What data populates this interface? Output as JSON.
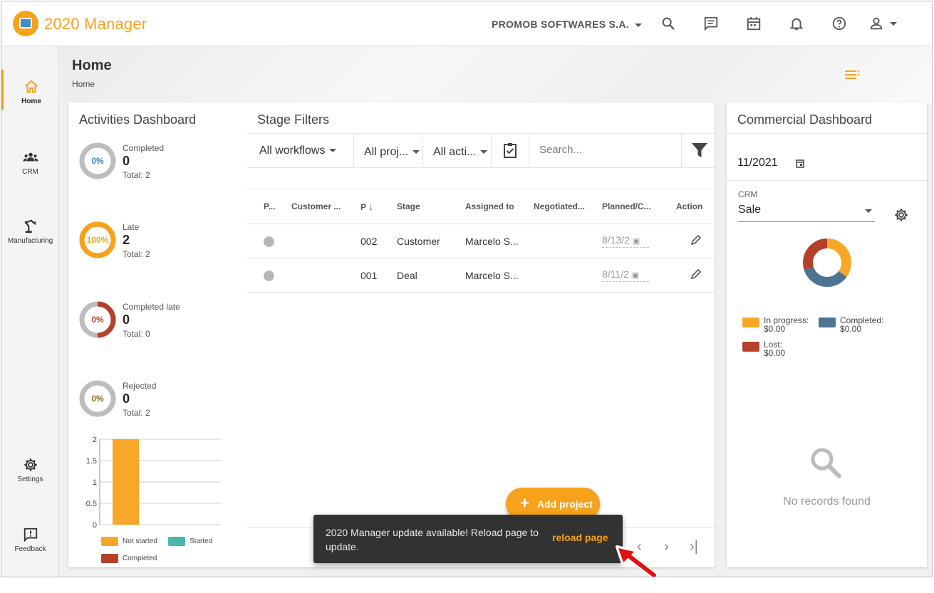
{
  "app": {
    "brand": "2020 Manager",
    "company": "PROMOB SOFTWARES S.A.",
    "accent": "#f7a21b"
  },
  "topbar": {
    "icons": [
      "search-icon",
      "chat-icon",
      "calendar-icon",
      "bell-icon",
      "help-icon",
      "user-icon"
    ]
  },
  "sidebar": {
    "items": [
      {
        "label": "Home",
        "icon": "home-icon"
      },
      {
        "label": "CRM",
        "icon": "group-icon"
      },
      {
        "label": "Manufacturing",
        "icon": "robot-arm-icon"
      },
      {
        "label": "Settings",
        "icon": "gear-icon"
      },
      {
        "label": "Feedback",
        "icon": "feedback-icon"
      }
    ]
  },
  "header": {
    "title": "Home",
    "breadcrumb": "Home"
  },
  "activities": {
    "title": "Activities Dashboard",
    "rings": [
      {
        "name": "Completed",
        "pct": "0%",
        "value": "0",
        "total": "Total: 2",
        "color": "#3a7fb0",
        "fill": 0
      },
      {
        "name": "Late",
        "pct": "100%",
        "value": "2",
        "total": "Total: 2",
        "color": "#f7a21b",
        "fill": 1
      },
      {
        "name": "Completed late",
        "pct": "0%",
        "value": "0",
        "total": "Total: 0",
        "color": "#b5412b",
        "fill": 0.5
      },
      {
        "name": "Rejected",
        "pct": "0%",
        "value": "0",
        "total": "Total: 2",
        "color": "#8a6d1c",
        "fill": 0
      }
    ],
    "legend": [
      "Not started",
      "Started",
      "Completed"
    ]
  },
  "chart_data": {
    "type": "bar",
    "categories": [
      "Not started"
    ],
    "series": [
      {
        "name": "Not started",
        "values": [
          2
        ],
        "color": "#f7a828"
      },
      {
        "name": "Started",
        "values": [
          0
        ],
        "color": "#4bb7aa"
      },
      {
        "name": "Completed",
        "values": [
          0
        ],
        "color": "#b5412b"
      }
    ],
    "yticks": [
      "2",
      "1.5",
      "1",
      "0.5",
      "0"
    ],
    "ylim": [
      0,
      2
    ],
    "grid": true,
    "legend_position": "bottom"
  },
  "stage": {
    "title": "Stage Filters",
    "filters": [
      "All workflows",
      "All proj...",
      "All acti..."
    ],
    "search_placeholder": "Search...",
    "columns": [
      "P...",
      "Customer ...",
      "P",
      "Stage",
      "Assigned to",
      "Negotiated...",
      "Planned/C...",
      "Action"
    ],
    "rows": [
      {
        "project": "002",
        "stage": "Customer",
        "assigned": "Marcelo S...",
        "planned": "8/13/2"
      },
      {
        "project": "001",
        "stage": "Deal",
        "assigned": "Marcelo S...",
        "planned": "8/11/2"
      }
    ],
    "add_project": "Add project"
  },
  "snackbar": {
    "message": "2020 Manager update available! Reload page to update.",
    "action": "reload page"
  },
  "commercial": {
    "title": "Commercial Dashboard",
    "date": "11/2021",
    "crm_label": "CRM",
    "crm_value": "Sale",
    "donut": {
      "in_progress": 0.35,
      "completed": 0.35,
      "lost": 0.3
    },
    "legend": [
      {
        "label": "In progress:",
        "value": "$0.00",
        "color": "#f7a828"
      },
      {
        "label": "Completed:",
        "value": "$0.00",
        "color": "#4d7493"
      },
      {
        "label": "Lost:",
        "value": "$0.00",
        "color": "#b5412b"
      }
    ],
    "no_records": "No records found"
  }
}
